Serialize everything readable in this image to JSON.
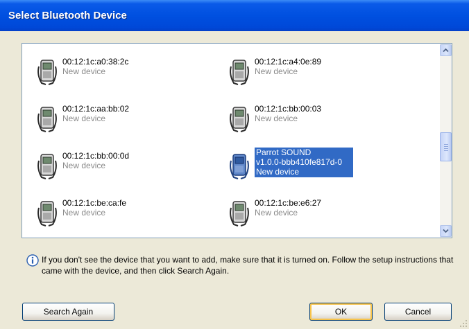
{
  "window": {
    "title": "Select Bluetooth Device"
  },
  "devices": [
    {
      "address": "00:12:1c:a0:38:2c",
      "status": "New device",
      "selected": false,
      "icon": "phone-icon"
    },
    {
      "address": "00:12:1c:a4:0e:89",
      "status": "New device",
      "selected": false,
      "icon": "phone-icon"
    },
    {
      "address": "00:12:1c:aa:bb:02",
      "status": "New device",
      "selected": false,
      "icon": "phone-icon"
    },
    {
      "address": "00:12:1c:bb:00:03",
      "status": "New device",
      "selected": false,
      "icon": "phone-icon"
    },
    {
      "address": "00:12:1c:bb:00:0d",
      "status": "New device",
      "selected": false,
      "icon": "phone-icon"
    },
    {
      "address": "Parrot SOUND",
      "address2": "v1.0.0-bbb410fe817d-0",
      "status": "New device",
      "selected": true,
      "icon": "phone-icon"
    },
    {
      "address": "00:12:1c:be:ca:fe",
      "status": "New device",
      "selected": false,
      "icon": "phone-icon"
    },
    {
      "address": "00:12:1c:be:e6:27",
      "status": "New device",
      "selected": false,
      "icon": "phone-icon"
    }
  ],
  "info": {
    "icon": "info-icon",
    "text": "If you don't see the device that you want to add, make sure that it is turned on. Follow the setup instructions that came with the device, and then click Search Again."
  },
  "buttons": {
    "search_again": "Search Again",
    "ok": "OK",
    "cancel": "Cancel"
  },
  "colors": {
    "title_bar": "#0050e0",
    "selection": "#316ac5",
    "dialog_bg": "#ece9d8"
  }
}
